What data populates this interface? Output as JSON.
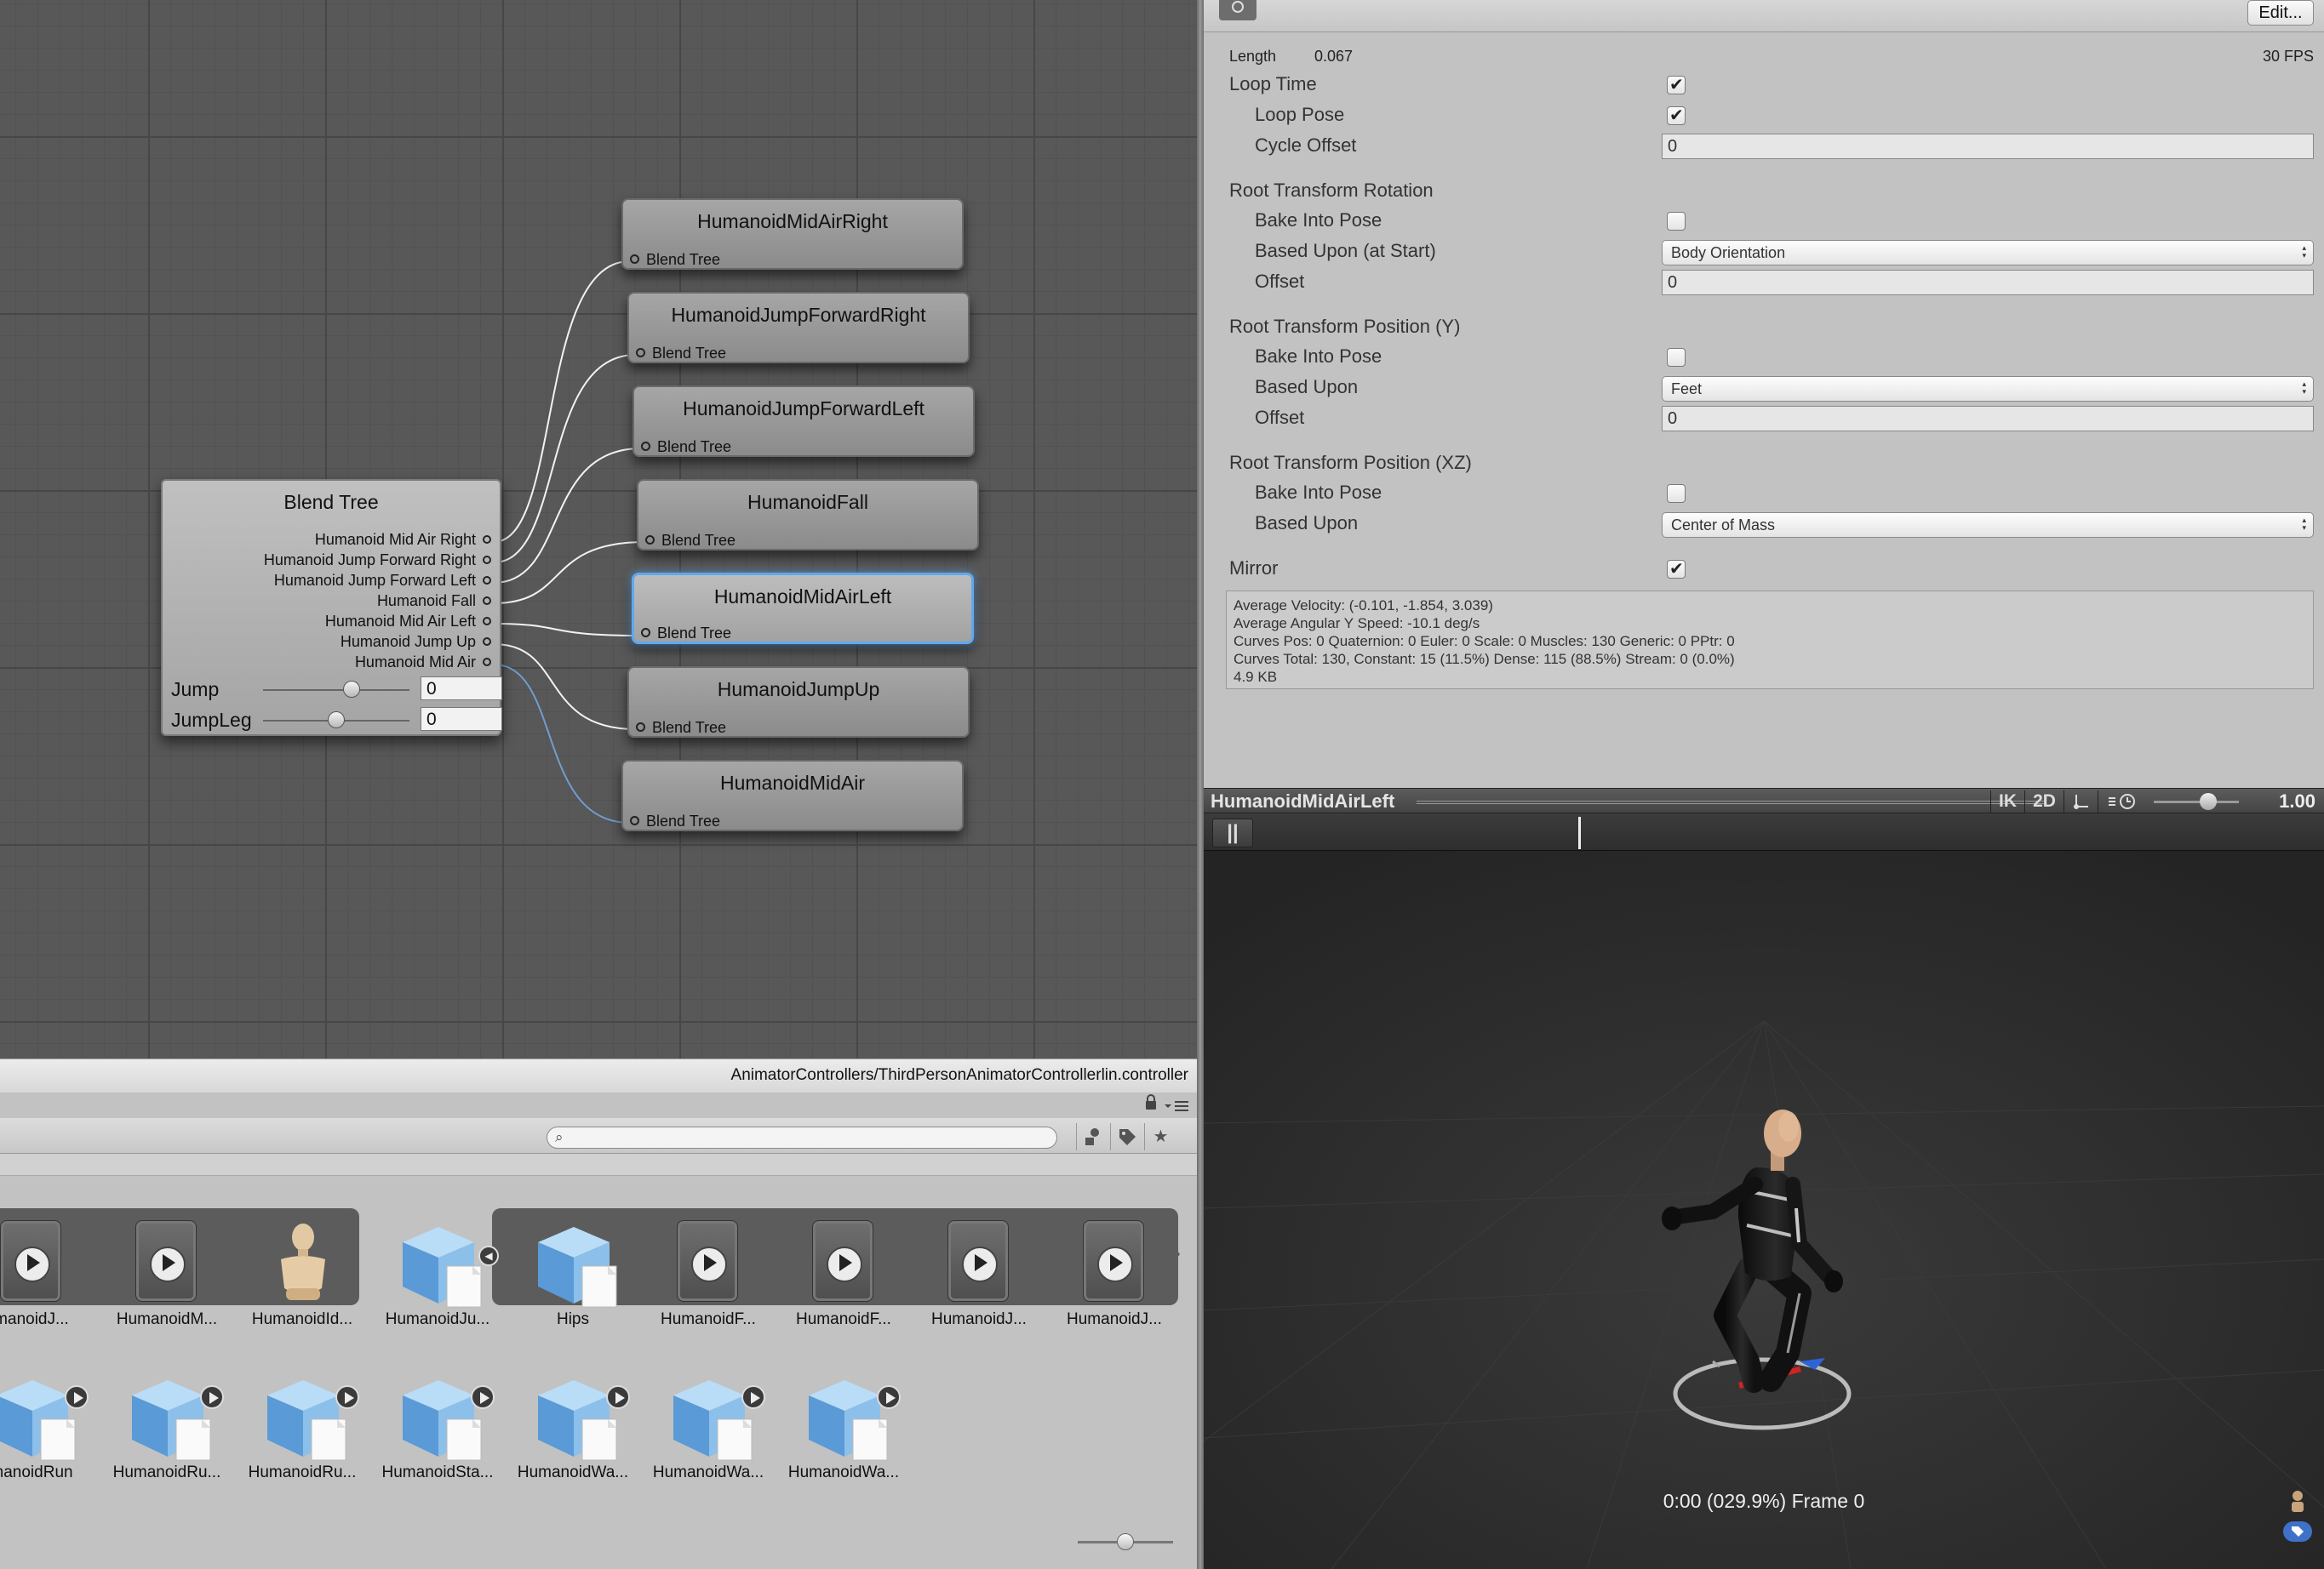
{
  "graph": {
    "blend_tree": {
      "title": "Blend Tree",
      "outputs": [
        "Humanoid Mid Air Right",
        "Humanoid Jump Forward Right",
        "Humanoid Jump Forward Left",
        "Humanoid Fall",
        "Humanoid Mid Air Left",
        "Humanoid Jump Up",
        "Humanoid Mid Air"
      ],
      "params": [
        {
          "name": "Jump",
          "value": "0",
          "slider": 0.62
        },
        {
          "name": "JumpLeg",
          "value": "0",
          "slider": 0.5
        }
      ]
    },
    "nodes": [
      {
        "title": "HumanoidMidAirRight",
        "sub": "Blend Tree"
      },
      {
        "title": "HumanoidJumpForwardRight",
        "sub": "Blend Tree"
      },
      {
        "title": "HumanoidJumpForwardLeft",
        "sub": "Blend Tree"
      },
      {
        "title": "HumanoidFall",
        "sub": "Blend Tree"
      },
      {
        "title": "HumanoidMidAirLeft",
        "sub": "Blend Tree"
      },
      {
        "title": "HumanoidJumpUp",
        "sub": "Blend Tree"
      },
      {
        "title": "HumanoidMidAir",
        "sub": "Blend Tree"
      }
    ],
    "selected_node": "HumanoidMidAirLeft",
    "path": "AnimatorControllers/ThirdPersonAnimatorControllerlin.controller"
  },
  "project": {
    "search_value": "",
    "row1": [
      {
        "label": "manoidJ...",
        "kind": "clip"
      },
      {
        "label": "HumanoidM...",
        "kind": "clip"
      },
      {
        "label": "HumanoidId...",
        "kind": "avatar"
      },
      {
        "label": "HumanoidJu...",
        "kind": "model"
      },
      {
        "label": "Hips",
        "kind": "model"
      },
      {
        "label": "HumanoidF...",
        "kind": "clip"
      },
      {
        "label": "HumanoidF...",
        "kind": "clip"
      },
      {
        "label": "HumanoidJ...",
        "kind": "clip"
      },
      {
        "label": "HumanoidJ...",
        "kind": "clip"
      }
    ],
    "row2": [
      {
        "label": "manoidRun",
        "kind": "model"
      },
      {
        "label": "HumanoidRu...",
        "kind": "model"
      },
      {
        "label": "HumanoidRu...",
        "kind": "model"
      },
      {
        "label": "HumanoidSta...",
        "kind": "model"
      },
      {
        "label": "HumanoidWa...",
        "kind": "model"
      },
      {
        "label": "HumanoidWa...",
        "kind": "model"
      },
      {
        "label": "HumanoidWa...",
        "kind": "model"
      }
    ],
    "icon_size_slider": 0.5
  },
  "inspector": {
    "edit_label": "Edit...",
    "length_label": "Length",
    "length_value": "0.067",
    "fps": "30 FPS",
    "loop_time": {
      "label": "Loop Time",
      "checked": true
    },
    "loop_pose": {
      "label": "Loop Pose",
      "checked": true
    },
    "cycle_offset": {
      "label": "Cycle Offset",
      "value": "0"
    },
    "rotation": {
      "header": "Root Transform Rotation",
      "bake_label": "Bake Into Pose",
      "bake": false,
      "based_label": "Based Upon (at Start)",
      "based_value": "Body Orientation",
      "offset_label": "Offset",
      "offset_value": "0"
    },
    "position_y": {
      "header": "Root Transform Position (Y)",
      "bake_label": "Bake Into Pose",
      "bake": false,
      "based_label": "Based Upon",
      "based_value": "Feet",
      "offset_label": "Offset",
      "offset_value": "0"
    },
    "position_xz": {
      "header": "Root Transform Position (XZ)",
      "bake_label": "Bake Into Pose",
      "bake": false,
      "based_label": "Based Upon",
      "based_value": "Center of Mass"
    },
    "mirror": {
      "label": "Mirror",
      "checked": true
    },
    "info": [
      "Average Velocity: (-0.101, -1.854, 3.039)",
      "Average Angular Y Speed: -10.1 deg/s",
      "Curves Pos: 0 Quaternion: 0 Euler: 0 Scale: 0 Muscles: 130 Generic: 0 PPtr: 0",
      "Curves Total: 130, Constant: 15 (11.5%) Dense: 115 (88.5%) Stream: 0 (0.0%)",
      "4.9 KB"
    ]
  },
  "preview": {
    "title": "HumanoidMidAirLeft",
    "ik_label": "IK",
    "twod_label": "2D",
    "speed": "1.00",
    "pause_label": "||",
    "timecode": "0:00 (029.9%) Frame 0"
  }
}
